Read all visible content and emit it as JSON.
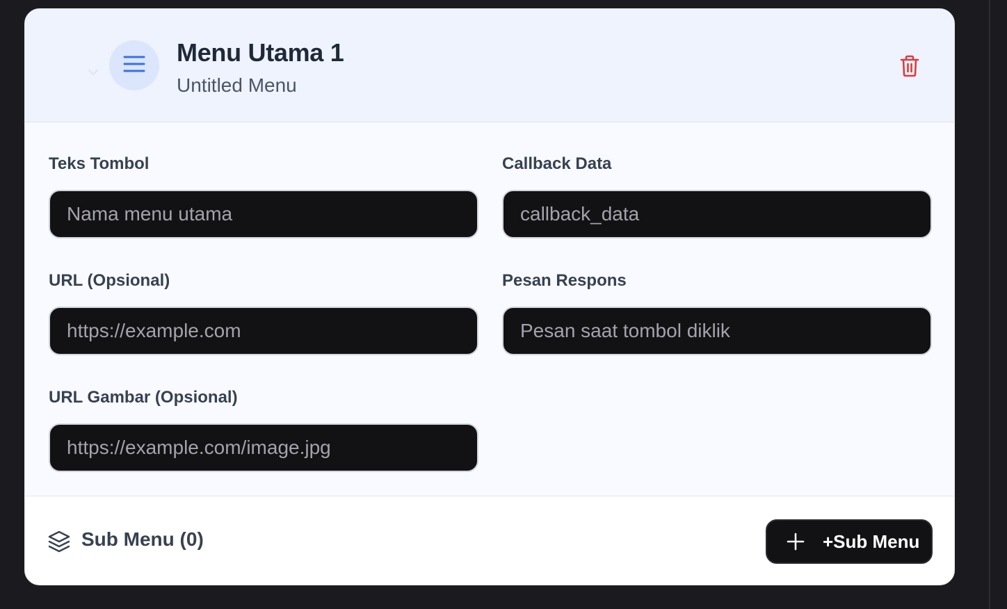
{
  "header": {
    "title": "Menu Utama 1",
    "subtitle": "Untitled Menu"
  },
  "form": {
    "button_text": {
      "label": "Teks Tombol",
      "placeholder": "Nama menu utama",
      "value": ""
    },
    "callback_data": {
      "label": "Callback Data",
      "placeholder": "callback_data",
      "value": ""
    },
    "url": {
      "label": "URL (Opsional)",
      "placeholder": "https://example.com",
      "value": ""
    },
    "response_message": {
      "label": "Pesan Respons",
      "placeholder": "Pesan saat tombol diklik",
      "value": ""
    },
    "image_url": {
      "label": "URL Gambar (Opsional)",
      "placeholder": "https://example.com/image.jpg",
      "value": ""
    }
  },
  "footer": {
    "submenu_label": "Sub Menu (0)",
    "add_submenu_label": "+Sub Menu"
  },
  "colors": {
    "accent": "#3b6ee8",
    "danger": "#dc3c3c",
    "header_bg": "#eef3fe",
    "input_bg": "#121215"
  },
  "icons": {
    "collapse": "chevron-down-icon",
    "menu": "hamburger-menu-icon",
    "delete": "trash-icon",
    "submenu": "layers-icon",
    "add": "plus-icon"
  }
}
